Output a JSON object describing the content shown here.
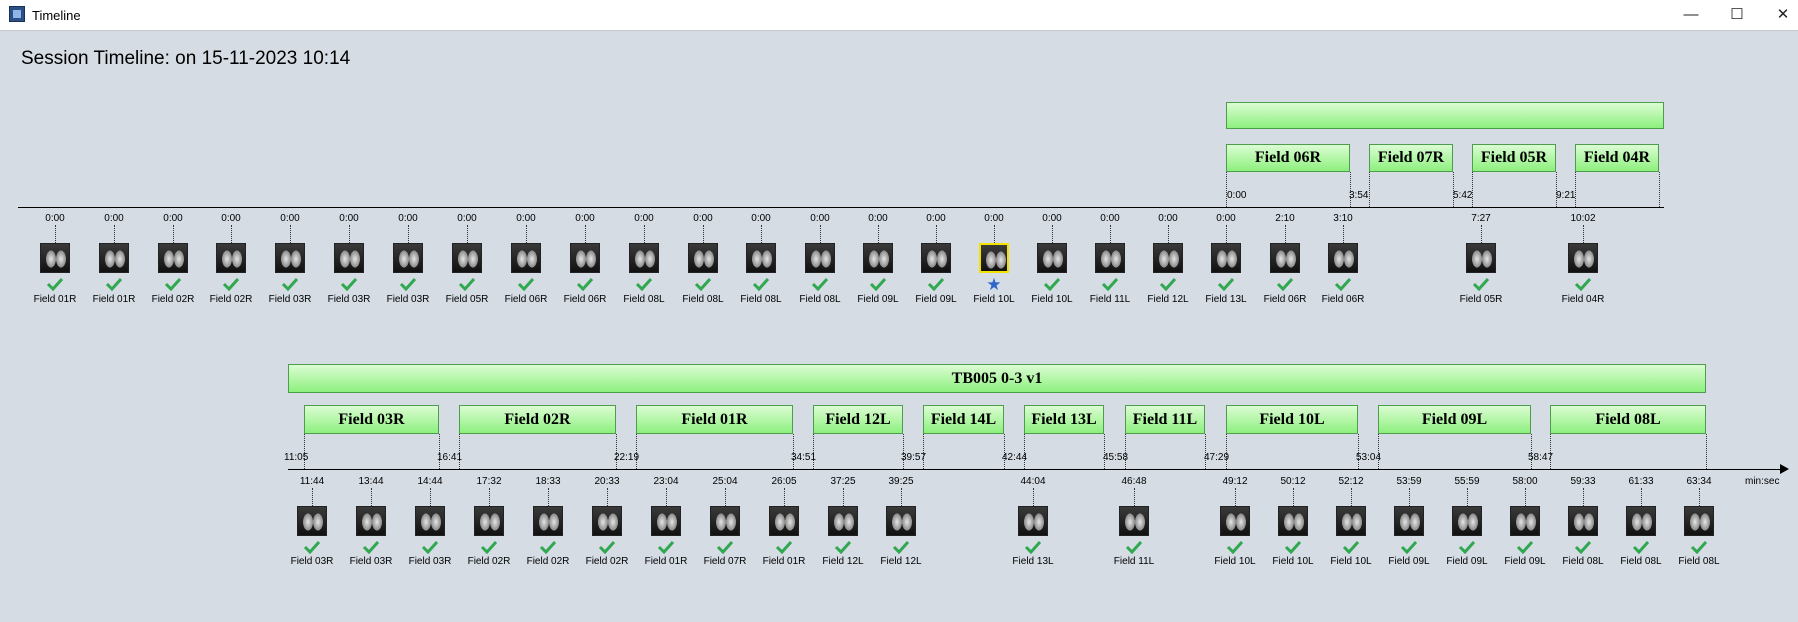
{
  "window": {
    "title": "Timeline",
    "minimize_glyph": "—",
    "maximize_glyph": "☐",
    "close_glyph": "✕",
    "icon": "app-icon"
  },
  "session_title": "Session Timeline: on 15-11-2023 10:14",
  "axis_unit": "min:sec",
  "colors": {
    "bar_fill": "#8df07e",
    "bar_border": "#4c9d4c",
    "check": "#2fa84f",
    "star": "#2e66c9",
    "selected_border": "#f3e100"
  },
  "row1": {
    "group_label": "",
    "fields": [
      {
        "label": "Field 06R",
        "start": "0:00"
      },
      {
        "label": "Field 07R",
        "start": "3:54"
      },
      {
        "label": "Field 05R",
        "start": "5:42"
      },
      {
        "label": "Field 04R",
        "start": "9:21"
      }
    ],
    "images": [
      {
        "time": "0:00",
        "label": "Field 01R"
      },
      {
        "time": "0:00",
        "label": "Field 01R"
      },
      {
        "time": "0:00",
        "label": "Field 02R"
      },
      {
        "time": "0:00",
        "label": "Field 02R"
      },
      {
        "time": "0:00",
        "label": "Field 03R"
      },
      {
        "time": "0:00",
        "label": "Field 03R"
      },
      {
        "time": "0:00",
        "label": "Field 03R"
      },
      {
        "time": "0:00",
        "label": "Field 05R"
      },
      {
        "time": "0:00",
        "label": "Field 06R"
      },
      {
        "time": "0:00",
        "label": "Field 06R"
      },
      {
        "time": "0:00",
        "label": "Field 08L"
      },
      {
        "time": "0:00",
        "label": "Field 08L"
      },
      {
        "time": "0:00",
        "label": "Field 08L"
      },
      {
        "time": "0:00",
        "label": "Field 08L"
      },
      {
        "time": "0:00",
        "label": "Field 09L"
      },
      {
        "time": "0:00",
        "label": "Field 09L"
      },
      {
        "time": "0:00",
        "label": "Field 10L",
        "selected": true,
        "marker": "star"
      },
      {
        "time": "0:00",
        "label": "Field 10L"
      },
      {
        "time": "0:00",
        "label": "Field 11L"
      },
      {
        "time": "0:00",
        "label": "Field 12L"
      },
      {
        "time": "0:00",
        "label": "Field 13L"
      },
      {
        "time": "2:10",
        "label": "Field 06R"
      },
      {
        "time": "3:10",
        "label": "Field 06R"
      },
      {
        "time": "7:27",
        "label": "Field 05R"
      },
      {
        "time": "10:02",
        "label": "Field 04R"
      }
    ]
  },
  "row2": {
    "group_label": "TB005 0-3 v1",
    "fields": [
      {
        "label": "Field 03R",
        "start": "11:05"
      },
      {
        "label": "Field 02R",
        "start": "16:41"
      },
      {
        "label": "Field 01R",
        "start": "22:19"
      },
      {
        "label": "Field 12L",
        "start": "34:51"
      },
      {
        "label": "Field 14L",
        "start": "39:57"
      },
      {
        "label": "Field 13L",
        "start": "42:44"
      },
      {
        "label": "Field 11L",
        "start": "45:58"
      },
      {
        "label": "Field 10L",
        "start": "47:29"
      },
      {
        "label": "Field 09L",
        "start": "53:04"
      },
      {
        "label": "Field 08L",
        "start": "58:47"
      }
    ],
    "images": [
      {
        "time": "11:44",
        "label": "Field 03R"
      },
      {
        "time": "13:44",
        "label": "Field 03R"
      },
      {
        "time": "14:44",
        "label": "Field 03R"
      },
      {
        "time": "17:32",
        "label": "Field 02R"
      },
      {
        "time": "18:33",
        "label": "Field 02R"
      },
      {
        "time": "20:33",
        "label": "Field 02R"
      },
      {
        "time": "23:04",
        "label": "Field 01R"
      },
      {
        "time": "25:04",
        "label": "Field 07R"
      },
      {
        "time": "26:05",
        "label": "Field 01R"
      },
      {
        "time": "37:25",
        "label": "Field 12L"
      },
      {
        "time": "39:25",
        "label": "Field 12L"
      },
      {
        "time": "44:04",
        "label": "Field 13L"
      },
      {
        "time": "46:48",
        "label": "Field 11L"
      },
      {
        "time": "49:12",
        "label": "Field 10L"
      },
      {
        "time": "50:12",
        "label": "Field 10L"
      },
      {
        "time": "52:12",
        "label": "Field 10L"
      },
      {
        "time": "53:59",
        "label": "Field 09L"
      },
      {
        "time": "55:59",
        "label": "Field 09L"
      },
      {
        "time": "58:00",
        "label": "Field 09L"
      },
      {
        "time": "59:33",
        "label": "Field 08L"
      },
      {
        "time": "61:33",
        "label": "Field 08L"
      },
      {
        "time": "63:34",
        "label": "Field 08L"
      }
    ]
  }
}
